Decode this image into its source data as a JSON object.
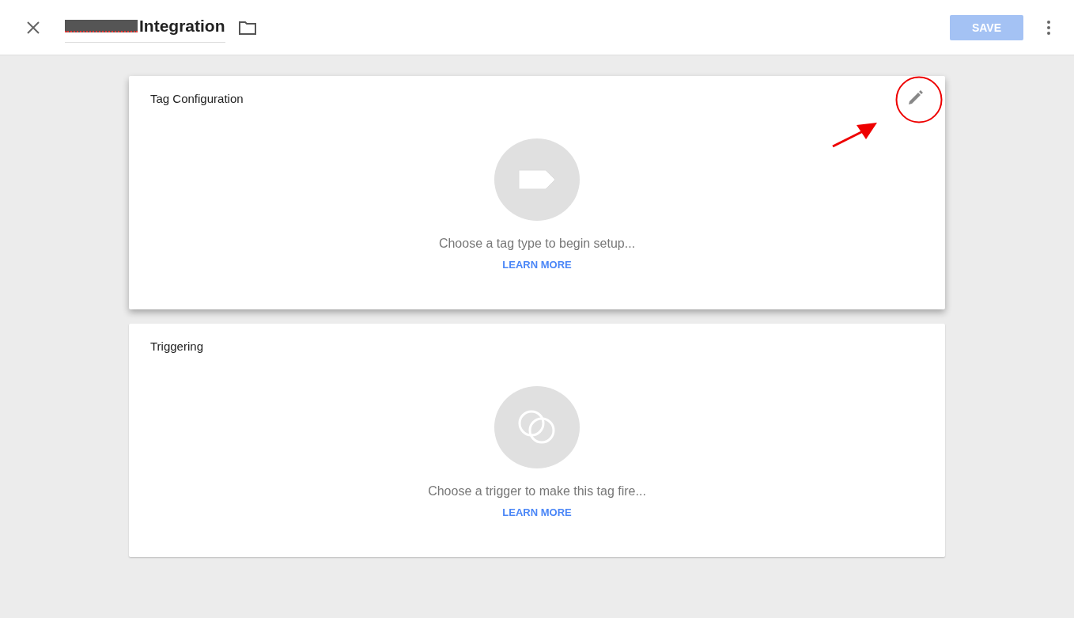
{
  "header": {
    "title": "Integration",
    "title_redacted": true,
    "save_button": {
      "label": "SAVE",
      "disabled": true
    }
  },
  "cards": [
    {
      "kind": "tag",
      "title": "Tag Configuration",
      "message": "Choose a tag type to begin setup...",
      "link": "LEARN MORE",
      "elevated": true,
      "annotated": true
    },
    {
      "kind": "trigger",
      "title": "Triggering",
      "message": "Choose a trigger to make this tag fire...",
      "link": "LEARN MORE",
      "elevated": false,
      "annotated": false
    }
  ]
}
